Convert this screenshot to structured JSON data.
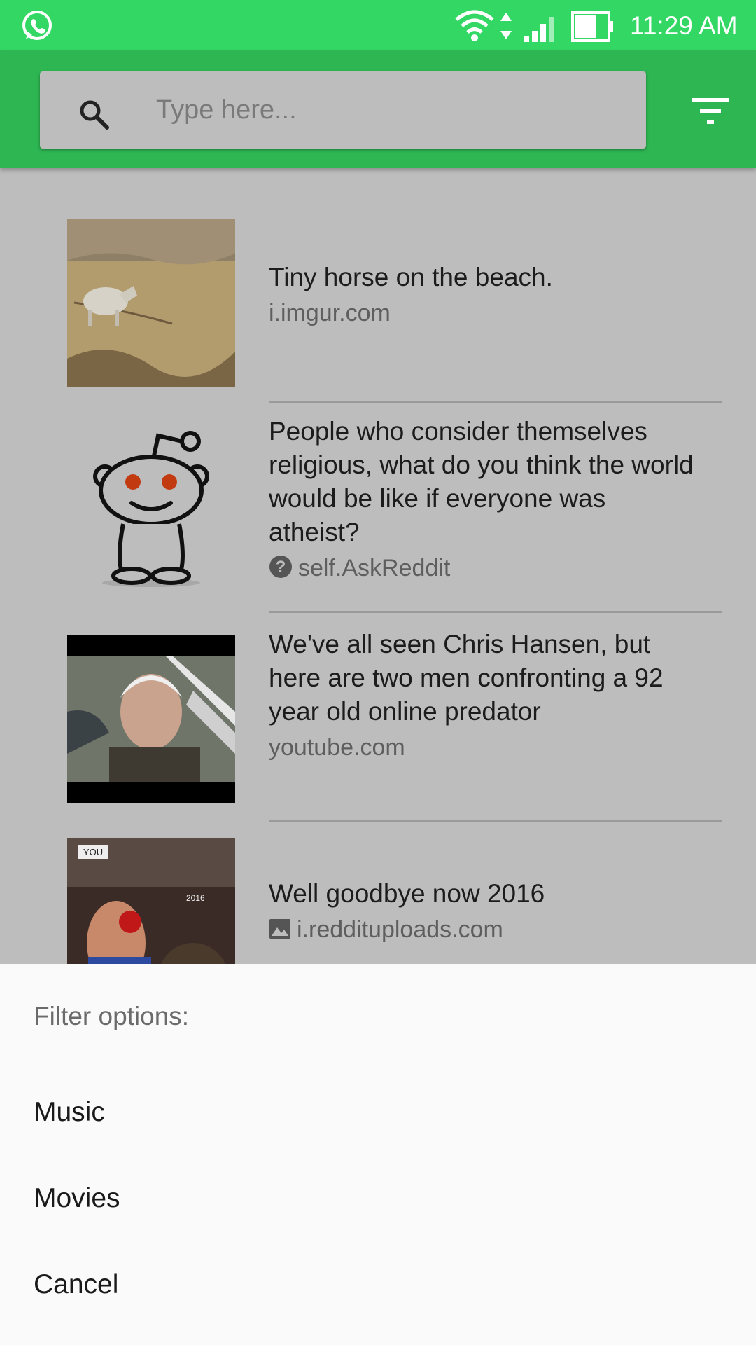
{
  "status_bar": {
    "time": "11:29 AM",
    "notification_icon": "whatsapp-icon",
    "accent_color": "#33d864"
  },
  "toolbar": {
    "search_placeholder": "Type here...",
    "search_icon": "search-icon",
    "filter_icon": "filter-icon",
    "color": "#2db652"
  },
  "posts": [
    {
      "title": "Tiny horse on the beach.",
      "domain": "i.imgur.com",
      "thumbnail": "horse-on-beach-photo"
    },
    {
      "title": "People who consider themselves religious, what do you think the world would be like if everyone was atheist?",
      "domain": "self.AskReddit",
      "thumbnail": "reddit-alien-icon",
      "domain_icon": "question-icon"
    },
    {
      "title": "We've all seen Chris Hansen, but here are two men confronting a 92 year old online predator",
      "domain": "youtube.com",
      "thumbnail": "old-man-video-still"
    },
    {
      "title": "Well goodbye now 2016",
      "domain": "i.reddituploads.com",
      "thumbnail": "boxing-meme-photo",
      "domain_icon": "image-icon"
    }
  ],
  "filter_sheet": {
    "title": "Filter options:",
    "options": [
      "Music",
      "Movies",
      "Cancel"
    ]
  }
}
